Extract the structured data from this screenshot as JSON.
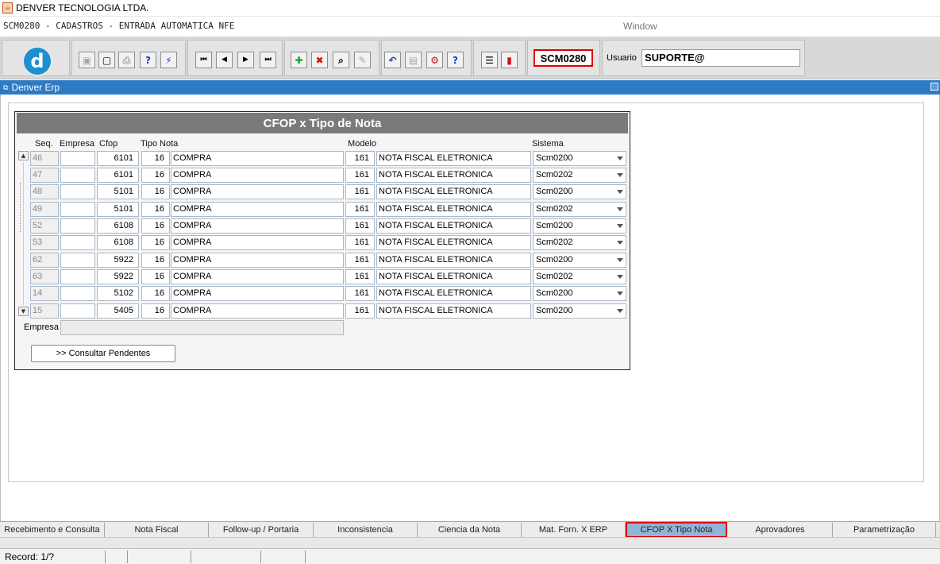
{
  "window": {
    "title": "DENVER TECNOLOGIA LTDA.",
    "form_title": "SCM0280 - CADASTROS - ENTRADA AUTOMATICA NFE",
    "menu_window": "Window"
  },
  "toolbar": {
    "logo_letter": "d",
    "buttons": [
      {
        "icon": "save-icon",
        "glyph": "▣"
      },
      {
        "icon": "screen-icon",
        "glyph": "▢"
      },
      {
        "icon": "print-icon",
        "glyph": "⎙"
      },
      {
        "icon": "query-help-icon",
        "glyph": "?"
      },
      {
        "icon": "execute-query-icon",
        "glyph": "⚡"
      },
      {
        "icon": "first-record-icon",
        "glyph": "⏮"
      },
      {
        "icon": "previous-record-icon",
        "glyph": "◀"
      },
      {
        "icon": "next-record-icon",
        "glyph": "▶"
      },
      {
        "icon": "last-record-icon",
        "glyph": "⏭"
      },
      {
        "icon": "insert-record-icon",
        "glyph": "✚"
      },
      {
        "icon": "delete-record-icon",
        "glyph": "✖"
      },
      {
        "icon": "search-icon",
        "glyph": "⌕"
      },
      {
        "icon": "eraser-icon",
        "glyph": "✎"
      },
      {
        "icon": "undo-icon",
        "glyph": "↶"
      },
      {
        "icon": "clipboard-icon",
        "glyph": "▤"
      },
      {
        "icon": "settings-icon",
        "glyph": "⚙"
      },
      {
        "icon": "help-icon",
        "glyph": "?"
      },
      {
        "icon": "menu-icon",
        "glyph": "☰"
      },
      {
        "icon": "exit-icon",
        "glyph": "▮"
      }
    ],
    "form_code": "SCM0280",
    "user_label": "Usuario",
    "user_value": "SUPORTE@"
  },
  "header_bar": {
    "title": "Denver Erp"
  },
  "block": {
    "title": "CFOP x Tipo de Nota",
    "columns": {
      "seq": "Seq.",
      "empresa": "Empresa",
      "cfop": "Cfop",
      "tipo_nota": "Tipo Nota",
      "modelo": "Modelo",
      "sistema": "Sistema"
    },
    "rows": [
      {
        "seq": "46",
        "empresa": "",
        "cfop": "6101",
        "tipo": "16",
        "tipo_desc": "COMPRA",
        "modelo": "161",
        "modelo_desc": "NOTA FISCAL ELETRONICA",
        "sistema": "Scm0200"
      },
      {
        "seq": "47",
        "empresa": "",
        "cfop": "6101",
        "tipo": "16",
        "tipo_desc": "COMPRA",
        "modelo": "161",
        "modelo_desc": "NOTA FISCAL ELETRONICA",
        "sistema": "Scm0202"
      },
      {
        "seq": "48",
        "empresa": "",
        "cfop": "5101",
        "tipo": "16",
        "tipo_desc": "COMPRA",
        "modelo": "161",
        "modelo_desc": "NOTA FISCAL ELETRONICA",
        "sistema": "Scm0200"
      },
      {
        "seq": "49",
        "empresa": "",
        "cfop": "5101",
        "tipo": "16",
        "tipo_desc": "COMPRA",
        "modelo": "161",
        "modelo_desc": "NOTA FISCAL ELETRONICA",
        "sistema": "Scm0202"
      },
      {
        "seq": "52",
        "empresa": "",
        "cfop": "6108",
        "tipo": "16",
        "tipo_desc": "COMPRA",
        "modelo": "161",
        "modelo_desc": "NOTA FISCAL ELETRONICA",
        "sistema": "Scm0200"
      },
      {
        "seq": "53",
        "empresa": "",
        "cfop": "6108",
        "tipo": "16",
        "tipo_desc": "COMPRA",
        "modelo": "161",
        "modelo_desc": "NOTA FISCAL ELETRONICA",
        "sistema": "Scm0202"
      },
      {
        "seq": "62",
        "empresa": "",
        "cfop": "5922",
        "tipo": "16",
        "tipo_desc": "COMPRA",
        "modelo": "161",
        "modelo_desc": "NOTA FISCAL ELETRONICA",
        "sistema": "Scm0200"
      },
      {
        "seq": "63",
        "empresa": "",
        "cfop": "5922",
        "tipo": "16",
        "tipo_desc": "COMPRA",
        "modelo": "161",
        "modelo_desc": "NOTA FISCAL ELETRONICA",
        "sistema": "Scm0202"
      },
      {
        "seq": "14",
        "empresa": "",
        "cfop": "5102",
        "tipo": "16",
        "tipo_desc": "COMPRA",
        "modelo": "161",
        "modelo_desc": "NOTA FISCAL ELETRONICA",
        "sistema": "Scm0200"
      },
      {
        "seq": "15",
        "empresa": "",
        "cfop": "5405",
        "tipo": "16",
        "tipo_desc": "COMPRA",
        "modelo": "161",
        "modelo_desc": "NOTA FISCAL ELETRONICA",
        "sistema": "Scm0200"
      }
    ],
    "empresa_label": "Empresa",
    "empresa_value": "",
    "consult_button": ">> Consultar Pendentes"
  },
  "tabs": [
    {
      "label": "Recebimento e Consulta",
      "active": false
    },
    {
      "label": "Nota Fiscal",
      "active": false
    },
    {
      "label": "Follow-up / Portaria",
      "active": false
    },
    {
      "label": "Inconsistencia",
      "active": false
    },
    {
      "label": "Ciencia da Nota",
      "active": false
    },
    {
      "label": "Mat. Forn. X ERP",
      "active": false
    },
    {
      "label": "CFOP X Tipo Nota",
      "active": true
    },
    {
      "label": "Aprovadores",
      "active": false
    },
    {
      "label": "Parametrização",
      "active": false
    }
  ],
  "status": {
    "record": "Record: 1/?"
  }
}
